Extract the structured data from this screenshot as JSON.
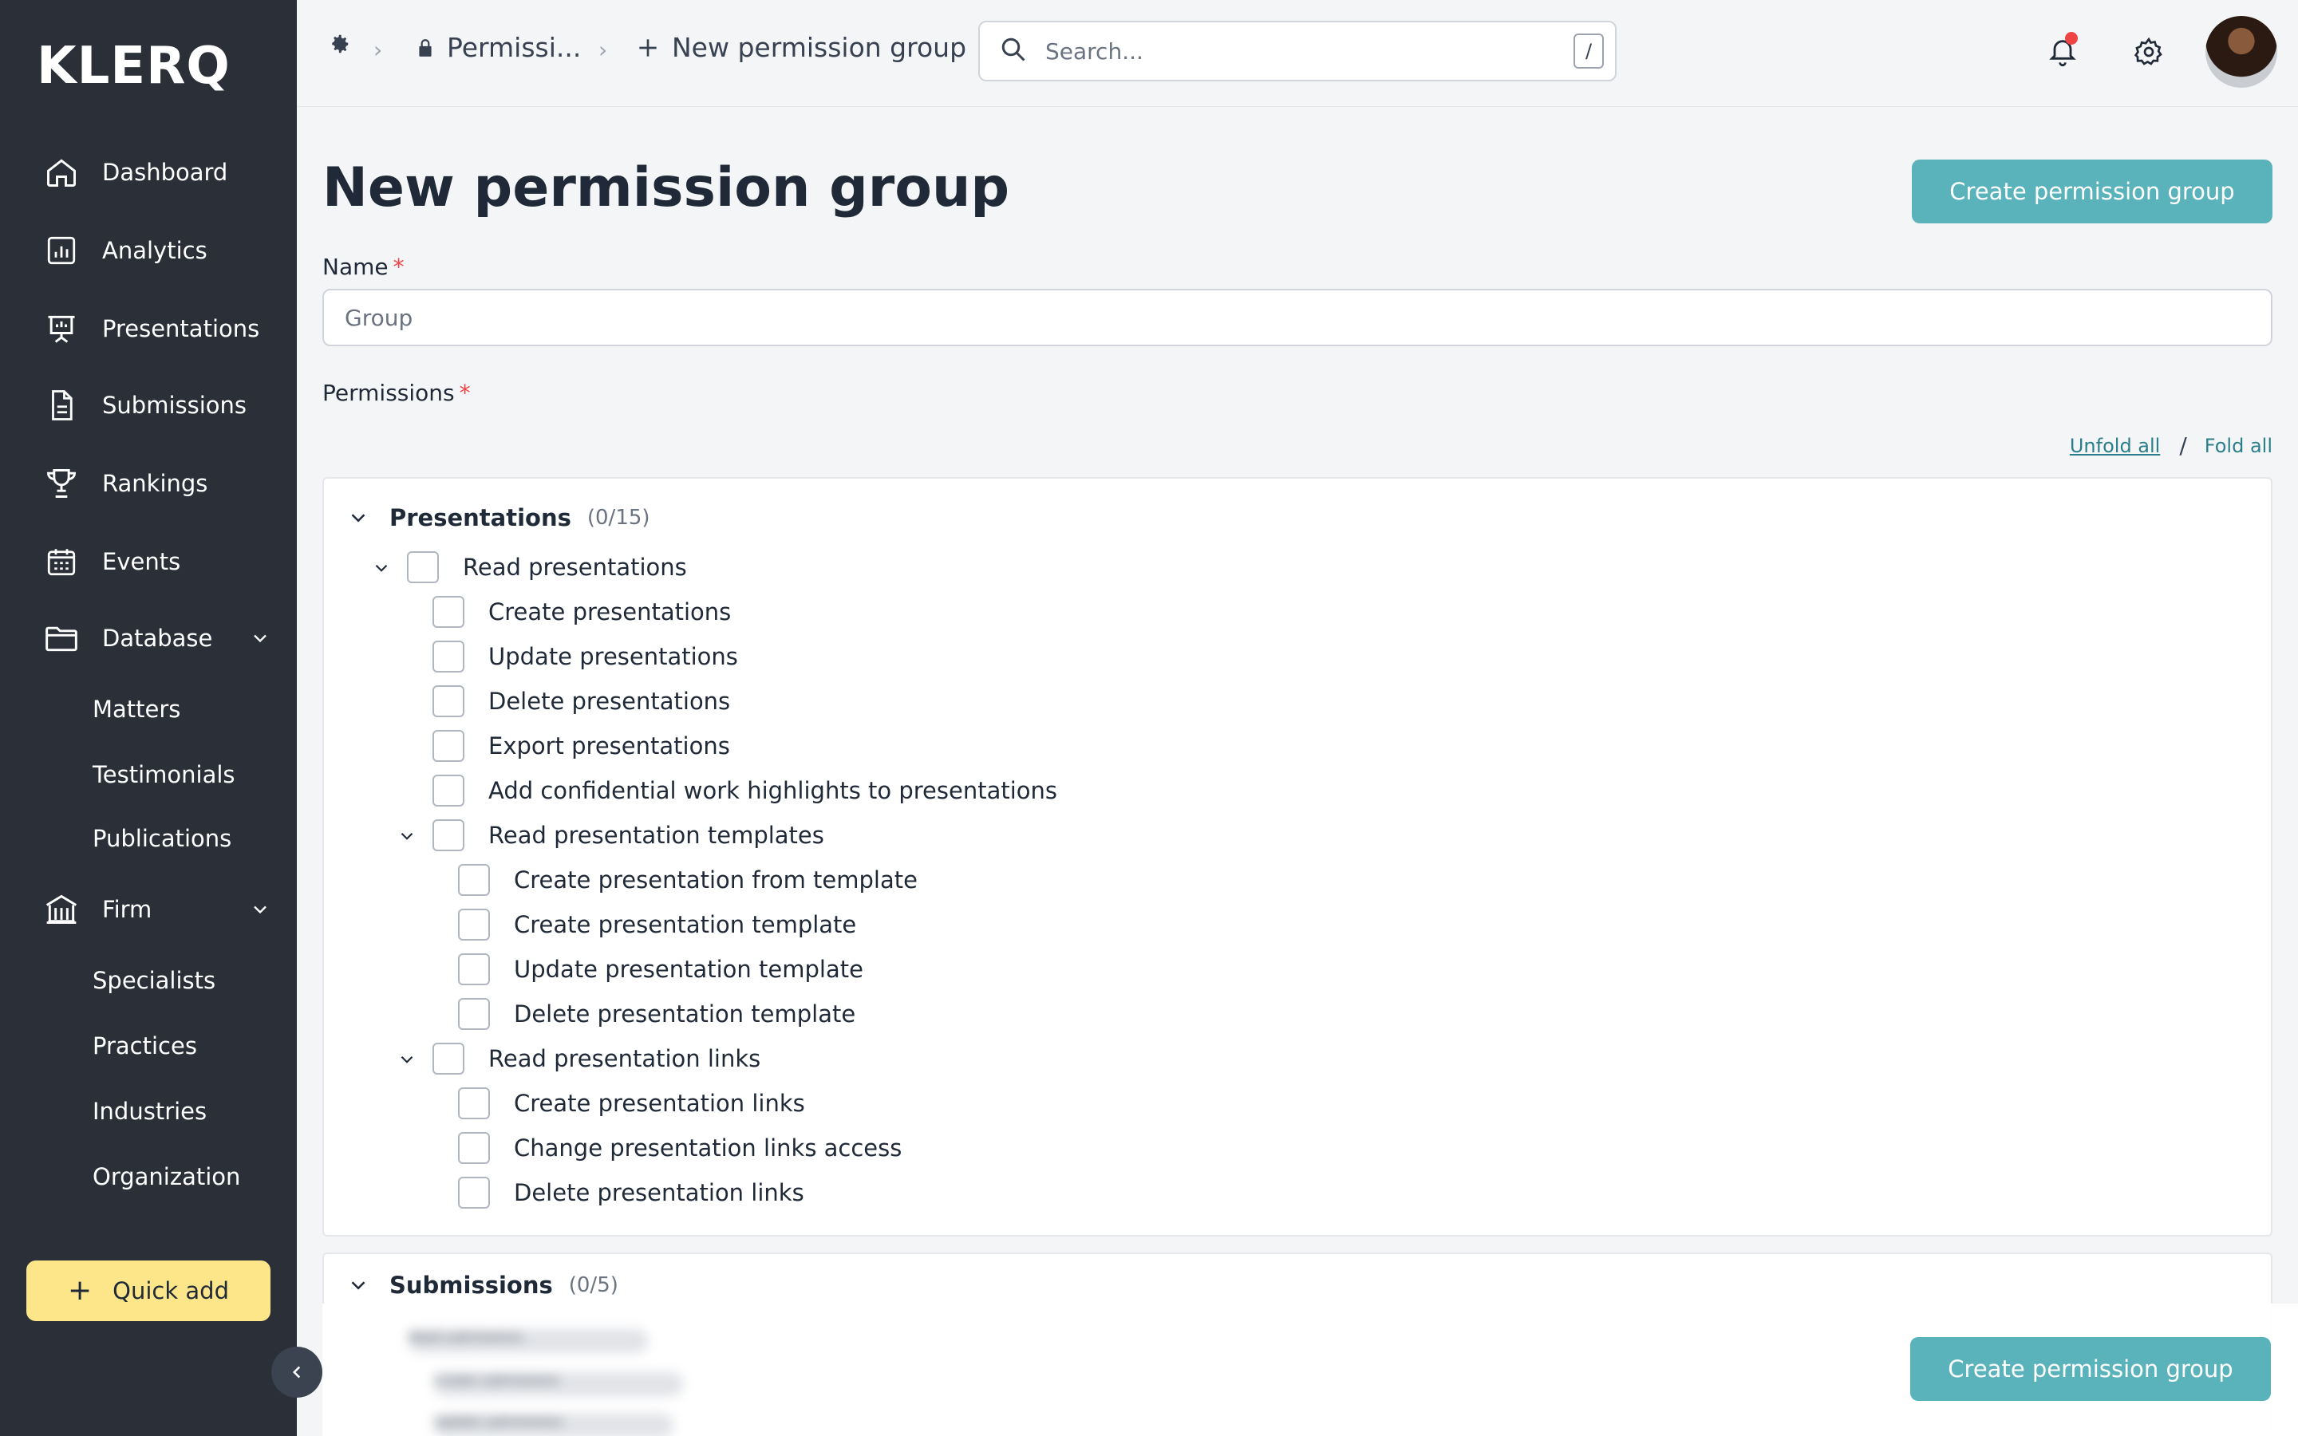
{
  "app": {
    "logo": "KLERQ"
  },
  "sidebar": {
    "items": [
      {
        "label": "Dashboard",
        "icon": "home-icon"
      },
      {
        "label": "Analytics",
        "icon": "analytics-icon"
      },
      {
        "label": "Presentations",
        "icon": "presentation-icon"
      },
      {
        "label": "Submissions",
        "icon": "document-icon"
      },
      {
        "label": "Rankings",
        "icon": "trophy-icon"
      },
      {
        "label": "Events",
        "icon": "calendar-icon"
      },
      {
        "label": "Database",
        "icon": "folder-icon"
      },
      {
        "label": "Firm",
        "icon": "bank-icon"
      }
    ],
    "database_sub": [
      "Matters",
      "Testimonials",
      "Publications"
    ],
    "firm_sub": [
      "Specialists",
      "Practices",
      "Industries",
      "Organization"
    ],
    "quick_add": "Quick add"
  },
  "topbar": {
    "crumb_permissions": "Permissi...",
    "crumb_current": "New permission group",
    "search_placeholder": "Search...",
    "search_shortcut": "/"
  },
  "main": {
    "title": "New permission group",
    "create_button": "Create permission group",
    "name_label": "Name",
    "name_placeholder": "Group",
    "required_mark": "*",
    "permissions_label": "Permissions",
    "unfold_all": "Unfold all",
    "fold_all": "Fold all",
    "slash": "/"
  },
  "sections": [
    {
      "title": "Presentations",
      "count": "(0/15)",
      "permissions": [
        "Read presentations",
        "Create presentations",
        "Update presentations",
        "Delete presentations",
        "Export presentations",
        "Add confidential work highlights to presentations",
        "Read presentation templates",
        "Create presentation from template",
        "Create presentation template",
        "Update presentation template",
        "Delete presentation template",
        "Read presentation links",
        "Create presentation links",
        "Change presentation links access",
        "Delete presentation links"
      ]
    },
    {
      "title": "Submissions",
      "count": "(0/5)",
      "permissions": [
        "Read submissions",
        "Create submissions",
        "Update submissions"
      ]
    }
  ],
  "colors": {
    "sidebar": "#2b3038",
    "accent": "#5ab3bb",
    "quick_add": "#fde68a",
    "required": "#ef4444",
    "link": "#2b7f8a"
  }
}
